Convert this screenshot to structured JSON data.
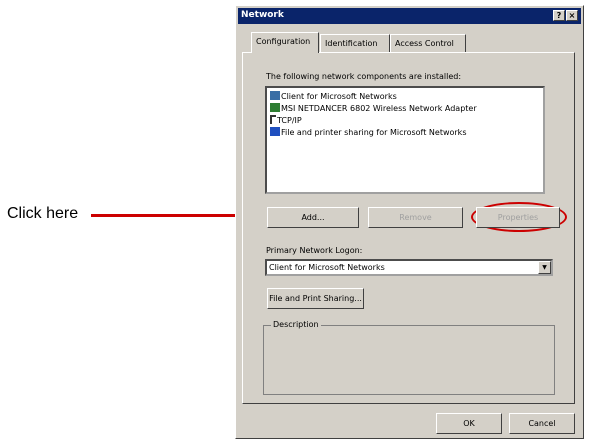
{
  "annotation": {
    "label": "Click here"
  },
  "dialog": {
    "title": "Network",
    "help_btn": "?",
    "close_btn": "×",
    "tabs": [
      {
        "label": "Configuration"
      },
      {
        "label": "Identification"
      },
      {
        "label": "Access Control"
      }
    ],
    "components_label": "The following network components are installed:",
    "components": [
      {
        "label": "Client for Microsoft Networks",
        "icon": "network-client-icon"
      },
      {
        "label": "MSI NETDANCER 6802 Wireless Network Adapter",
        "icon": "network-adapter-icon"
      },
      {
        "label": "TCP/IP",
        "icon": "protocol-icon"
      },
      {
        "label": "File and printer sharing for Microsoft Networks",
        "icon": "file-sharing-service-icon"
      }
    ],
    "add_label": "Add...",
    "remove_label": "Remove",
    "properties_label": "Properties",
    "logon_label": "Primary Network Logon:",
    "logon_value": "Client for Microsoft Networks",
    "file_print_label": "File and Print Sharing...",
    "description_label": "Description",
    "ok_label": "OK",
    "cancel_label": "Cancel"
  },
  "colors": {
    "titlebar": "#0a246a",
    "face": "#d4d0c8",
    "annotation": "#cc0000"
  }
}
